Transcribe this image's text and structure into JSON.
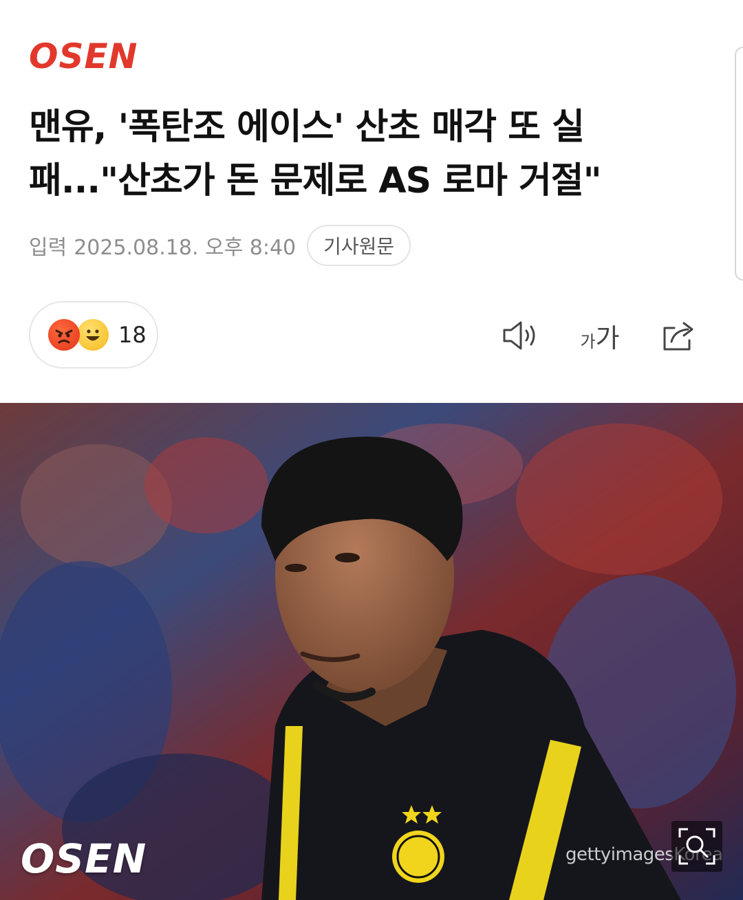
{
  "header": {
    "logo_text": "OSEN",
    "logo_color": "#e2382c"
  },
  "article": {
    "title": "맨유, '폭탄조 에이스' 산초 매각 또 실패...\"산초가 돈 문제로 AS 로마 거절\"",
    "meta_label": "입력",
    "published": "2025.08.18. 오후 8:40",
    "origin_button": "기사원문"
  },
  "reactions": {
    "count": "18",
    "emojis": [
      "angry-emoji",
      "happy-emoji"
    ]
  },
  "toolbar": {
    "audio_icon": "speaker-icon",
    "font_small": "가",
    "font_large": "가",
    "share_icon": "share-icon"
  },
  "photo": {
    "watermark": "OSEN",
    "credit": "gettyimagesKorea",
    "zoom_icon": "zoom-icon"
  }
}
